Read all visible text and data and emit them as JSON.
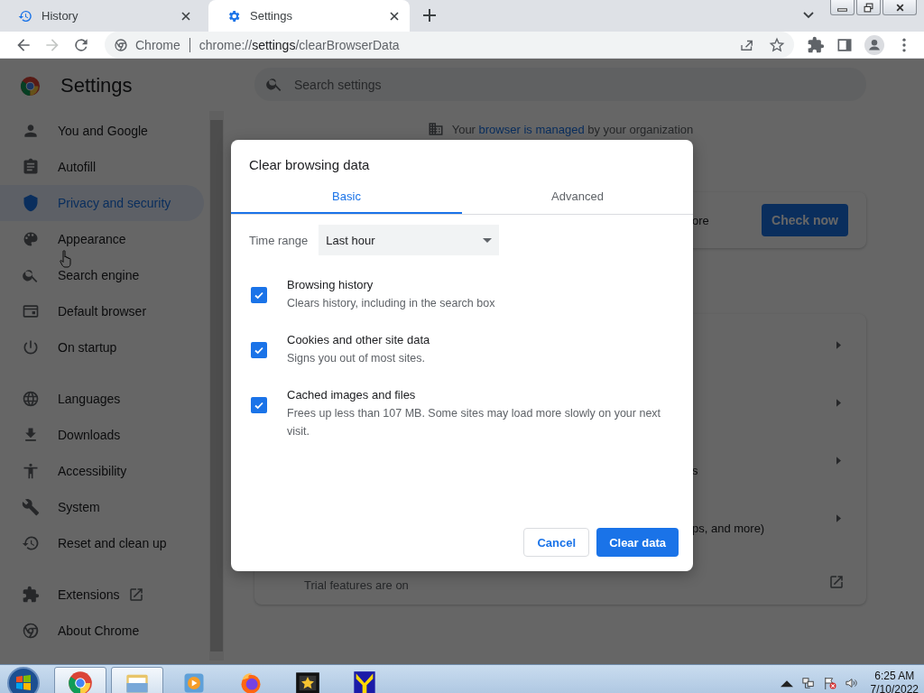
{
  "tabs": [
    {
      "title": "History",
      "selected": false
    },
    {
      "title": "Settings",
      "selected": true
    }
  ],
  "address_bar": {
    "site_label": "Chrome",
    "scheme": "chrome://",
    "host": "settings",
    "path": "/clearBrowserData"
  },
  "sidebar": {
    "title": "Settings",
    "groups": [
      [
        {
          "label": "You and Google",
          "selected": false
        },
        {
          "label": "Autofill",
          "selected": false
        },
        {
          "label": "Privacy and security",
          "selected": true
        },
        {
          "label": "Appearance",
          "selected": false
        },
        {
          "label": "Search engine",
          "selected": false
        },
        {
          "label": "Default browser",
          "selected": false
        },
        {
          "label": "On startup",
          "selected": false
        }
      ],
      [
        {
          "label": "Languages",
          "selected": false
        },
        {
          "label": "Downloads",
          "selected": false
        },
        {
          "label": "Accessibility",
          "selected": false
        },
        {
          "label": "System",
          "selected": false
        },
        {
          "label": "Reset and clean up",
          "selected": false
        }
      ],
      [
        {
          "label": "Extensions",
          "selected": false,
          "kind": "external"
        },
        {
          "label": "About Chrome",
          "selected": false,
          "kind": "page"
        }
      ]
    ]
  },
  "search": {
    "placeholder": "Search settings"
  },
  "managed_notice": {
    "before": "Your ",
    "link": "browser is managed",
    "after": " by your organization"
  },
  "safety_check": {
    "text_fragment": "ore",
    "button": "Check now"
  },
  "privacy_rows": [
    {
      "kind": "arrow"
    },
    {
      "kind": "arrow"
    },
    {
      "kind": "arrow",
      "fragment": "s"
    },
    {
      "kind": "arrow",
      "fragment": "ps, and more)"
    },
    {
      "kind": "external",
      "text": "Trial features are on"
    }
  ],
  "dialog": {
    "title": "Clear browsing data",
    "tabs": [
      {
        "label": "Basic",
        "selected": true
      },
      {
        "label": "Advanced",
        "selected": false
      }
    ],
    "time_range": {
      "label": "Time range",
      "value": "Last hour"
    },
    "options": [
      {
        "title": "Browsing history",
        "description": "Clears history, including in the search box",
        "checked": true
      },
      {
        "title": "Cookies and other site data",
        "description": "Signs you out of most sites.",
        "checked": true
      },
      {
        "title": "Cached images and files",
        "description": "Frees up less than 107 MB. Some sites may load more slowly on your next visit.",
        "checked": true
      }
    ],
    "buttons": {
      "cancel": "Cancel",
      "confirm": "Clear data"
    }
  },
  "taskbar": {
    "apps": [
      {
        "running": true
      },
      {
        "running": true
      },
      {
        "running": false
      },
      {
        "running": false
      },
      {
        "running": false
      },
      {
        "running": false
      }
    ],
    "time": "6:25 AM",
    "date": "7/10/2022"
  }
}
